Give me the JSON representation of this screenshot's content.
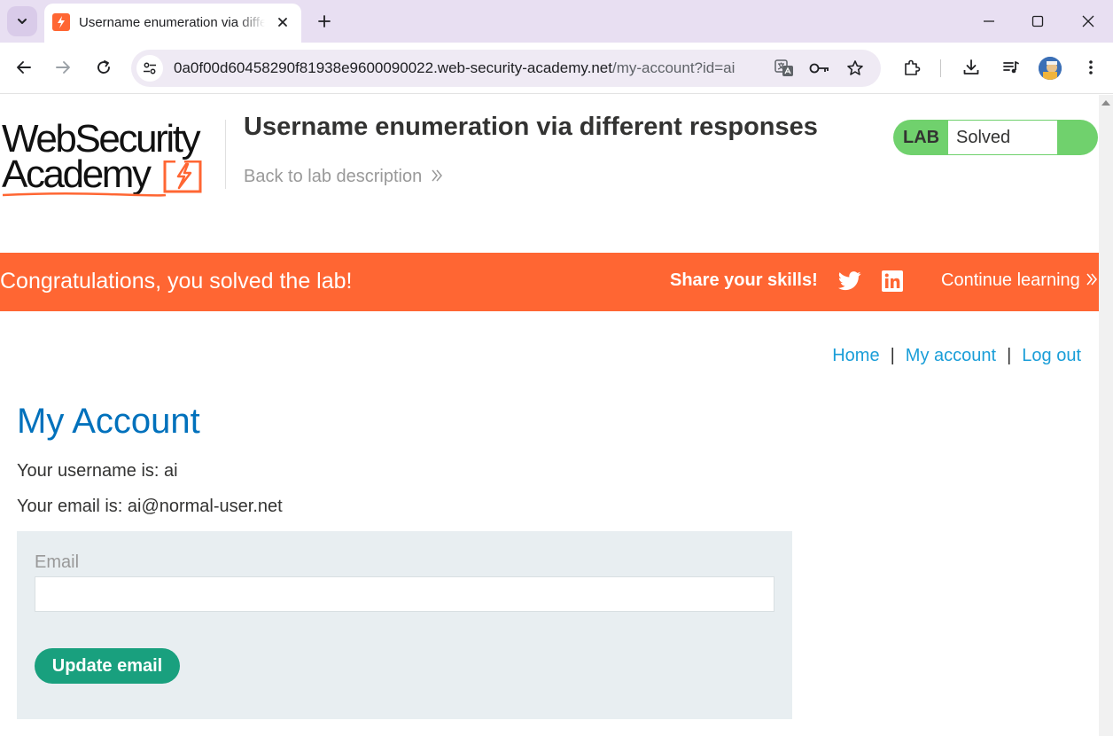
{
  "browser": {
    "tab": {
      "title": "Username enumeration via different responses"
    },
    "address_bar": {
      "host": "0a0f00d60458290f81938e9600090022.web-security-academy.net",
      "path": "/my-account?id=ai"
    }
  },
  "header": {
    "logo": {
      "line1": "WebSecurity",
      "line2": "Academy"
    },
    "lab_title": "Username enumeration via different responses",
    "back_link": "Back to lab description",
    "lab_badge": {
      "label": "LAB",
      "status": "Solved"
    }
  },
  "banner": {
    "message": "Congratulations, you solved the lab!",
    "share_label": "Share your skills!",
    "continue_label": "Continue learning"
  },
  "nav": {
    "home": "Home",
    "separator": "|",
    "my_account": "My account",
    "log_out": "Log out"
  },
  "account": {
    "heading": "My Account",
    "username_line": "Your username is: ai",
    "email_line": "Your email is: ai@normal-user.net"
  },
  "email_form": {
    "label": "Email",
    "value": "",
    "button_label": "Update email"
  },
  "colors": {
    "brand_orange": "#ff6633",
    "lab_green": "#70d16d",
    "link_blue": "#1a9ed8",
    "heading_blue": "#0071bc",
    "button_green": "#19a07e",
    "tabbar_bg": "#e8dff2"
  }
}
